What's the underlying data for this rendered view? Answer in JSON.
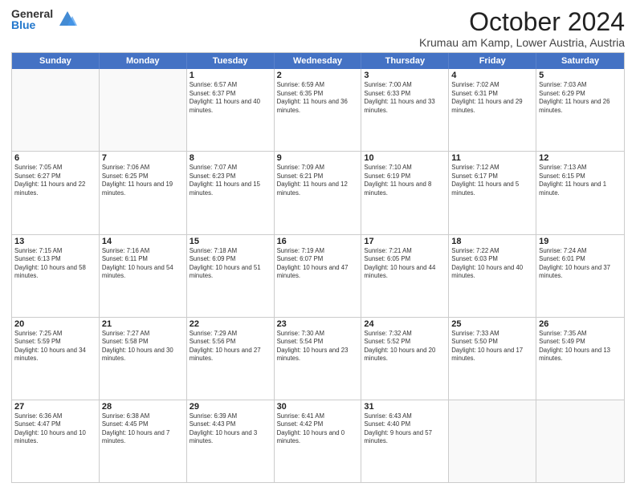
{
  "logo": {
    "general": "General",
    "blue": "Blue"
  },
  "title": "October 2024",
  "location": "Krumau am Kamp, Lower Austria, Austria",
  "header_days": [
    "Sunday",
    "Monday",
    "Tuesday",
    "Wednesday",
    "Thursday",
    "Friday",
    "Saturday"
  ],
  "weeks": [
    [
      {
        "day": "",
        "sunrise": "",
        "sunset": "",
        "daylight": ""
      },
      {
        "day": "",
        "sunrise": "",
        "sunset": "",
        "daylight": ""
      },
      {
        "day": "1",
        "sunrise": "Sunrise: 6:57 AM",
        "sunset": "Sunset: 6:37 PM",
        "daylight": "Daylight: 11 hours and 40 minutes."
      },
      {
        "day": "2",
        "sunrise": "Sunrise: 6:59 AM",
        "sunset": "Sunset: 6:35 PM",
        "daylight": "Daylight: 11 hours and 36 minutes."
      },
      {
        "day": "3",
        "sunrise": "Sunrise: 7:00 AM",
        "sunset": "Sunset: 6:33 PM",
        "daylight": "Daylight: 11 hours and 33 minutes."
      },
      {
        "day": "4",
        "sunrise": "Sunrise: 7:02 AM",
        "sunset": "Sunset: 6:31 PM",
        "daylight": "Daylight: 11 hours and 29 minutes."
      },
      {
        "day": "5",
        "sunrise": "Sunrise: 7:03 AM",
        "sunset": "Sunset: 6:29 PM",
        "daylight": "Daylight: 11 hours and 26 minutes."
      }
    ],
    [
      {
        "day": "6",
        "sunrise": "Sunrise: 7:05 AM",
        "sunset": "Sunset: 6:27 PM",
        "daylight": "Daylight: 11 hours and 22 minutes."
      },
      {
        "day": "7",
        "sunrise": "Sunrise: 7:06 AM",
        "sunset": "Sunset: 6:25 PM",
        "daylight": "Daylight: 11 hours and 19 minutes."
      },
      {
        "day": "8",
        "sunrise": "Sunrise: 7:07 AM",
        "sunset": "Sunset: 6:23 PM",
        "daylight": "Daylight: 11 hours and 15 minutes."
      },
      {
        "day": "9",
        "sunrise": "Sunrise: 7:09 AM",
        "sunset": "Sunset: 6:21 PM",
        "daylight": "Daylight: 11 hours and 12 minutes."
      },
      {
        "day": "10",
        "sunrise": "Sunrise: 7:10 AM",
        "sunset": "Sunset: 6:19 PM",
        "daylight": "Daylight: 11 hours and 8 minutes."
      },
      {
        "day": "11",
        "sunrise": "Sunrise: 7:12 AM",
        "sunset": "Sunset: 6:17 PM",
        "daylight": "Daylight: 11 hours and 5 minutes."
      },
      {
        "day": "12",
        "sunrise": "Sunrise: 7:13 AM",
        "sunset": "Sunset: 6:15 PM",
        "daylight": "Daylight: 11 hours and 1 minute."
      }
    ],
    [
      {
        "day": "13",
        "sunrise": "Sunrise: 7:15 AM",
        "sunset": "Sunset: 6:13 PM",
        "daylight": "Daylight: 10 hours and 58 minutes."
      },
      {
        "day": "14",
        "sunrise": "Sunrise: 7:16 AM",
        "sunset": "Sunset: 6:11 PM",
        "daylight": "Daylight: 10 hours and 54 minutes."
      },
      {
        "day": "15",
        "sunrise": "Sunrise: 7:18 AM",
        "sunset": "Sunset: 6:09 PM",
        "daylight": "Daylight: 10 hours and 51 minutes."
      },
      {
        "day": "16",
        "sunrise": "Sunrise: 7:19 AM",
        "sunset": "Sunset: 6:07 PM",
        "daylight": "Daylight: 10 hours and 47 minutes."
      },
      {
        "day": "17",
        "sunrise": "Sunrise: 7:21 AM",
        "sunset": "Sunset: 6:05 PM",
        "daylight": "Daylight: 10 hours and 44 minutes."
      },
      {
        "day": "18",
        "sunrise": "Sunrise: 7:22 AM",
        "sunset": "Sunset: 6:03 PM",
        "daylight": "Daylight: 10 hours and 40 minutes."
      },
      {
        "day": "19",
        "sunrise": "Sunrise: 7:24 AM",
        "sunset": "Sunset: 6:01 PM",
        "daylight": "Daylight: 10 hours and 37 minutes."
      }
    ],
    [
      {
        "day": "20",
        "sunrise": "Sunrise: 7:25 AM",
        "sunset": "Sunset: 5:59 PM",
        "daylight": "Daylight: 10 hours and 34 minutes."
      },
      {
        "day": "21",
        "sunrise": "Sunrise: 7:27 AM",
        "sunset": "Sunset: 5:58 PM",
        "daylight": "Daylight: 10 hours and 30 minutes."
      },
      {
        "day": "22",
        "sunrise": "Sunrise: 7:29 AM",
        "sunset": "Sunset: 5:56 PM",
        "daylight": "Daylight: 10 hours and 27 minutes."
      },
      {
        "day": "23",
        "sunrise": "Sunrise: 7:30 AM",
        "sunset": "Sunset: 5:54 PM",
        "daylight": "Daylight: 10 hours and 23 minutes."
      },
      {
        "day": "24",
        "sunrise": "Sunrise: 7:32 AM",
        "sunset": "Sunset: 5:52 PM",
        "daylight": "Daylight: 10 hours and 20 minutes."
      },
      {
        "day": "25",
        "sunrise": "Sunrise: 7:33 AM",
        "sunset": "Sunset: 5:50 PM",
        "daylight": "Daylight: 10 hours and 17 minutes."
      },
      {
        "day": "26",
        "sunrise": "Sunrise: 7:35 AM",
        "sunset": "Sunset: 5:49 PM",
        "daylight": "Daylight: 10 hours and 13 minutes."
      }
    ],
    [
      {
        "day": "27",
        "sunrise": "Sunrise: 6:36 AM",
        "sunset": "Sunset: 4:47 PM",
        "daylight": "Daylight: 10 hours and 10 minutes."
      },
      {
        "day": "28",
        "sunrise": "Sunrise: 6:38 AM",
        "sunset": "Sunset: 4:45 PM",
        "daylight": "Daylight: 10 hours and 7 minutes."
      },
      {
        "day": "29",
        "sunrise": "Sunrise: 6:39 AM",
        "sunset": "Sunset: 4:43 PM",
        "daylight": "Daylight: 10 hours and 3 minutes."
      },
      {
        "day": "30",
        "sunrise": "Sunrise: 6:41 AM",
        "sunset": "Sunset: 4:42 PM",
        "daylight": "Daylight: 10 hours and 0 minutes."
      },
      {
        "day": "31",
        "sunrise": "Sunrise: 6:43 AM",
        "sunset": "Sunset: 4:40 PM",
        "daylight": "Daylight: 9 hours and 57 minutes."
      },
      {
        "day": "",
        "sunrise": "",
        "sunset": "",
        "daylight": ""
      },
      {
        "day": "",
        "sunrise": "",
        "sunset": "",
        "daylight": ""
      }
    ]
  ]
}
